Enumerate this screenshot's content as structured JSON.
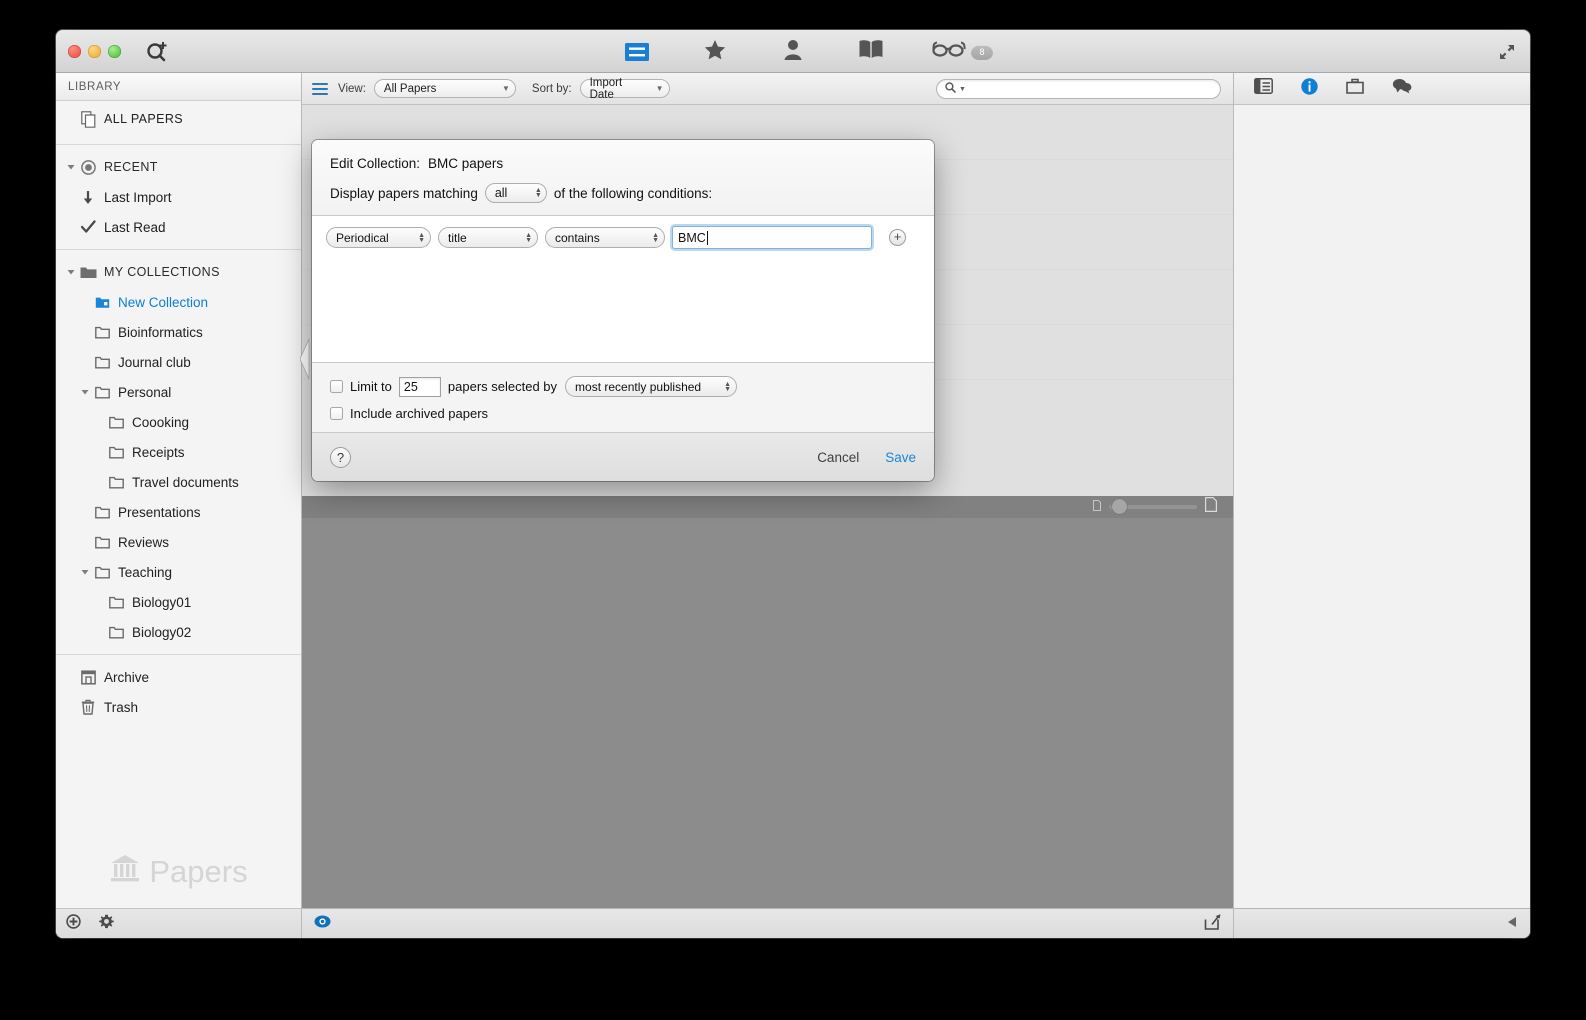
{
  "window": {
    "titlebar": {
      "traffic_lights": [
        "close",
        "minimize",
        "zoom"
      ],
      "search_add_icon": "search-add-icon",
      "fullscreen_icon": "fullscreen-icon",
      "center_buttons": [
        {
          "name": "library-view-button",
          "icon": "library-list-icon",
          "active": true
        },
        {
          "name": "favorites-button",
          "icon": "star-icon",
          "active": false
        },
        {
          "name": "authors-button",
          "icon": "person-icon",
          "active": false
        },
        {
          "name": "journals-button",
          "icon": "book-icon",
          "active": false
        },
        {
          "name": "reading-list-button",
          "icon": "glasses-icon",
          "active": false,
          "badge": "8"
        }
      ]
    }
  },
  "sidebar": {
    "header": "LIBRARY",
    "all_papers": {
      "label": "ALL PAPERS",
      "icon": "papers-stack-icon"
    },
    "recent": {
      "label": "RECENT",
      "icon": "recent-clock-icon",
      "items": [
        {
          "label": "Last Import",
          "icon": "down-arrow-icon"
        },
        {
          "label": "Last Read",
          "icon": "checkmark-icon"
        }
      ]
    },
    "collections": {
      "label": "MY COLLECTIONS",
      "icon": "folder-filled-icon",
      "items": [
        {
          "label": "New Collection",
          "icon": "smart-collection-icon",
          "indent": 1,
          "selected": true,
          "expandable": false
        },
        {
          "label": "Bioinformatics",
          "icon": "folder-icon",
          "indent": 1,
          "selected": false,
          "expandable": false
        },
        {
          "label": "Journal club",
          "icon": "folder-icon",
          "indent": 1,
          "selected": false,
          "expandable": false
        },
        {
          "label": "Personal",
          "icon": "folder-icon",
          "indent": 1,
          "selected": false,
          "expandable": true
        },
        {
          "label": "Coooking",
          "icon": "folder-icon",
          "indent": 2,
          "selected": false,
          "expandable": false
        },
        {
          "label": "Receipts",
          "icon": "folder-icon",
          "indent": 2,
          "selected": false,
          "expandable": false
        },
        {
          "label": "Travel documents",
          "icon": "folder-icon",
          "indent": 2,
          "selected": false,
          "expandable": false
        },
        {
          "label": "Presentations",
          "icon": "folder-icon",
          "indent": 1,
          "selected": false,
          "expandable": false
        },
        {
          "label": "Reviews",
          "icon": "folder-icon",
          "indent": 1,
          "selected": false,
          "expandable": false
        },
        {
          "label": "Teaching",
          "icon": "folder-icon",
          "indent": 1,
          "selected": false,
          "expandable": true
        },
        {
          "label": "Biology01",
          "icon": "folder-icon",
          "indent": 2,
          "selected": false,
          "expandable": false
        },
        {
          "label": "Biology02",
          "icon": "folder-icon",
          "indent": 2,
          "selected": false,
          "expandable": false
        }
      ]
    },
    "bottom_items": [
      {
        "label": "Archive",
        "icon": "archive-box-icon"
      },
      {
        "label": "Trash",
        "icon": "trash-icon"
      }
    ],
    "watermark": "Papers",
    "footer": {
      "add_icon": "add-circle-icon",
      "settings_icon": "gear-icon"
    }
  },
  "main": {
    "filterbar": {
      "list_icon": "hamburger-list-icon",
      "view_label": "View:",
      "view_value": "All Papers",
      "sort_label": "Sort by:",
      "sort_value": "Import Date",
      "search_placeholder": "",
      "search_value": "",
      "search_icon": "search-icon"
    },
    "size_slider": {
      "small_icon": "small-document-icon",
      "large_icon": "large-document-icon",
      "value": 10
    },
    "footer": {
      "preview_icon": "eye-icon",
      "share_icon": "share-icon"
    }
  },
  "inspector": {
    "toolbar_buttons": [
      {
        "name": "inspector-details-button",
        "icon": "panel-layout-icon",
        "active": false
      },
      {
        "name": "inspector-info-button",
        "icon": "info-circle-icon",
        "active": true
      },
      {
        "name": "inspector-supplements-button",
        "icon": "supplement-box-icon",
        "active": false
      },
      {
        "name": "inspector-notes-button",
        "icon": "speech-bubbles-icon",
        "active": false
      }
    ],
    "collapse_icon": "collapse-left-triangle-icon"
  },
  "dialog": {
    "title_label": "Edit Collection:",
    "title_value": "BMC papers",
    "matching_prefix": "Display papers matching",
    "matching_value": "all",
    "matching_suffix": "of the following conditions:",
    "rule": {
      "field": "Periodical",
      "attribute": "title",
      "operator": "contains",
      "value": "BMC",
      "add_button": "+"
    },
    "options": {
      "limit_checked": false,
      "limit_prefix": "Limit to",
      "limit_count": "25",
      "limit_mid": "papers selected by",
      "limit_selector": "most recently published",
      "archived_checked": false,
      "archived_label": "Include archived papers"
    },
    "footer": {
      "help": "?",
      "cancel": "Cancel",
      "save": "Save"
    }
  },
  "colors": {
    "accent_blue": "#1a86d8",
    "selected_text": "#0a7fd4",
    "toolbar_active": "#1a7fd4"
  }
}
